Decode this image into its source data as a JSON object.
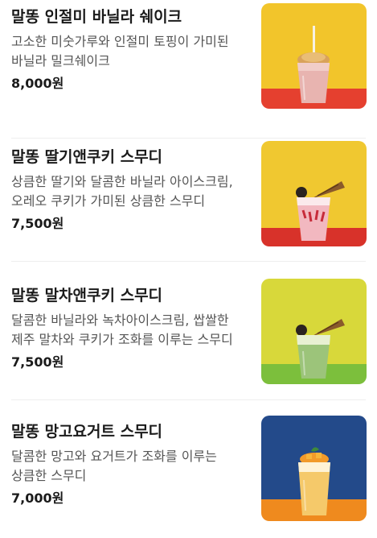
{
  "menu": {
    "items": [
      {
        "name": "말똥 인절미 바닐라 쉐이크",
        "description": "고소한 미숫가루와 인절미 토핑이 가미된 바닐라 밀크쉐이크",
        "price": "8,000원",
        "image_icon": "injeolmi-shake-photo",
        "colors": {
          "top": "#f2c52b",
          "bottom": "#e5402f",
          "drink": "#e8b4b0"
        }
      },
      {
        "name": "말똥 딸기앤쿠키 스무디",
        "description": "상큼한 딸기와 달콤한 바닐라 아이스크림, 오레오 쿠키가 가미된 상큼한 스무디",
        "price": "7,500원",
        "image_icon": "strawberry-cookie-smoothie-photo",
        "colors": {
          "top": "#f0c830",
          "bottom": "#d8322a",
          "drink": "#f2b8c0"
        }
      },
      {
        "name": "말똥 말차앤쿠키 스무디",
        "description": "달콤한 바닐라와 녹차아이스크림, 쌉쌀한 제주 말차와 쿠키가 조화를 이루는 스무디",
        "price": "7,500원",
        "image_icon": "matcha-cookie-smoothie-photo",
        "colors": {
          "top": "#d8d83a",
          "bottom": "#7cbf3c",
          "drink": "#9cc47a"
        }
      },
      {
        "name": "말똥 망고요거트 스무디",
        "description": "달콤한 망고와 요거트가 조화를 이루는 상큼한 스무디",
        "price": "7,000원",
        "image_icon": "mango-yogurt-smoothie-photo",
        "colors": {
          "top": "#234a8a",
          "bottom": "#ef8a1e",
          "drink": "#f5c96a"
        }
      }
    ]
  }
}
